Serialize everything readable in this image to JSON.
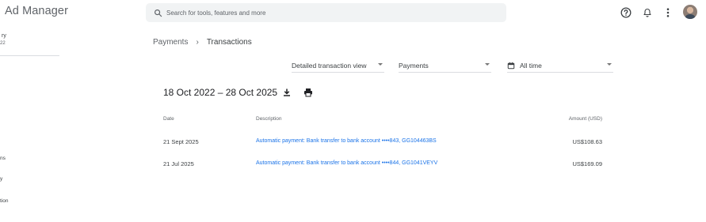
{
  "header": {
    "app_title": "Ad Manager",
    "search_placeholder": "Search for tools, features and more"
  },
  "sidebar": {
    "account_name": "ry",
    "account_id": "22",
    "items": [
      {
        "label": "ns"
      },
      {
        "label": "y"
      },
      {
        "label": "tion"
      }
    ]
  },
  "breadcrumb": {
    "parent": "Payments",
    "separator": "›",
    "current": "Transactions"
  },
  "filters": {
    "view": "Detailed transaction view",
    "type": "Payments",
    "date": "All time"
  },
  "summary": {
    "date_range": "18 Oct 2022 – 28 Oct 2025"
  },
  "table": {
    "columns": {
      "date": "Date",
      "description": "Description",
      "amount": "Amount (USD)"
    },
    "rows": [
      {
        "date": "21 Sept 2025",
        "description": "Automatic payment: Bank transfer to bank account ••••843, GG104463BS",
        "amount": "US$108.63"
      },
      {
        "date": "21 Jul 2025",
        "description": "Automatic payment: Bank transfer to bank account ••••844, GG1041VEYV",
        "amount": "US$169.09"
      }
    ]
  },
  "icons": {
    "search": "search-icon",
    "help": "help-icon",
    "notifications": "bell-icon",
    "more": "more-vert-icon",
    "calendar": "calendar-icon",
    "download": "download-icon",
    "print": "print-icon"
  }
}
